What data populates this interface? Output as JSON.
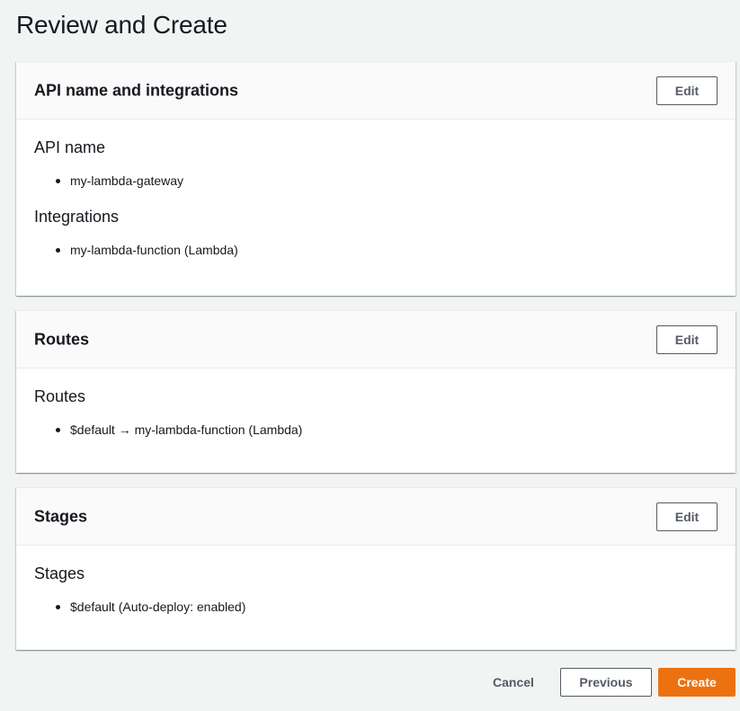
{
  "page": {
    "title": "Review and Create"
  },
  "panels": [
    {
      "title": "API name and integrations",
      "edit_label": "Edit",
      "sections": [
        {
          "heading": "API name",
          "items": [
            "my-lambda-gateway"
          ]
        },
        {
          "heading": "Integrations",
          "items": [
            "my-lambda-function (Lambda)"
          ]
        }
      ]
    },
    {
      "title": "Routes",
      "edit_label": "Edit",
      "sections": [
        {
          "heading": "Routes",
          "items": [
            "$default → my-lambda-function (Lambda)"
          ]
        }
      ]
    },
    {
      "title": "Stages",
      "edit_label": "Edit",
      "sections": [
        {
          "heading": "Stages",
          "items": [
            "$default (Auto-deploy: enabled)"
          ]
        }
      ]
    }
  ],
  "footer": {
    "cancel_label": "Cancel",
    "previous_label": "Previous",
    "create_label": "Create"
  },
  "colors": {
    "primary": "#ec7211",
    "background": "#f2f3f3",
    "text": "#16191f",
    "secondary_text": "#545b64"
  }
}
